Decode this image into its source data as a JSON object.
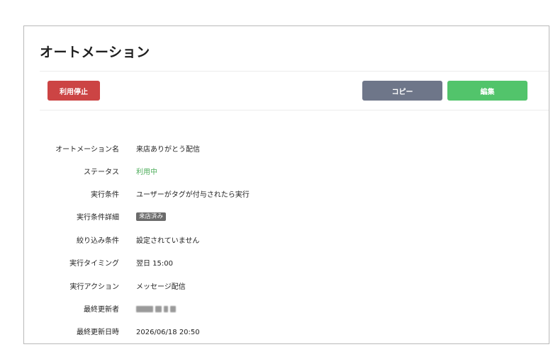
{
  "header": {
    "title": "オートメーション"
  },
  "toolbar": {
    "stop_label": "利用停止",
    "copy_label": "コピー",
    "edit_label": "編集"
  },
  "colors": {
    "danger": "#cc4444",
    "secondary": "#6e7689",
    "primary": "#52c46b",
    "status_active": "#4fae5c"
  },
  "details": {
    "name": {
      "label": "オートメーション名",
      "value": "来店ありがとう配信"
    },
    "status": {
      "label": "ステータス",
      "value": "利用中"
    },
    "trigger": {
      "label": "実行条件",
      "value": "ユーザーがタグが付与されたら実行"
    },
    "trigger_detail": {
      "label": "実行条件詳細",
      "tag": "来店済み"
    },
    "filter": {
      "label": "絞り込み条件",
      "value": "設定されていません"
    },
    "timing": {
      "label": "実行タイミング",
      "value": "翌日 15:00"
    },
    "action": {
      "label": "実行アクション",
      "value": "メッセージ配信"
    },
    "updated_by": {
      "label": "最終更新者"
    },
    "updated_at": {
      "label": "最終更新日時",
      "value": "2026/06/18 20:50"
    }
  }
}
